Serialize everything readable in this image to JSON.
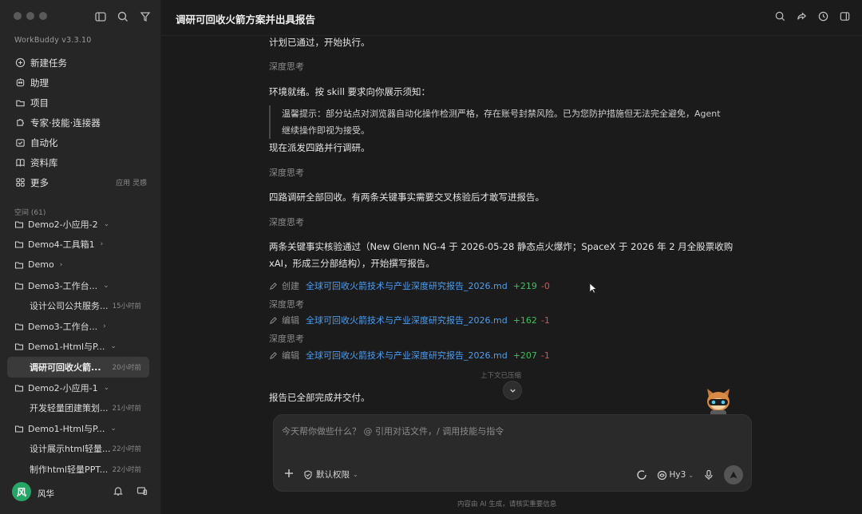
{
  "app": {
    "version": "WorkBuddy v3.3.10"
  },
  "sidebar": {
    "nav": [
      {
        "label": "新建任务",
        "icon": "plus-circle-icon"
      },
      {
        "label": "助理",
        "icon": "assistant-icon"
      },
      {
        "label": "项目",
        "icon": "project-icon"
      },
      {
        "label": "专家·技能·连接器",
        "icon": "puzzle-icon"
      },
      {
        "label": "自动化",
        "icon": "calendar-check-icon"
      },
      {
        "label": "资料库",
        "icon": "book-icon"
      },
      {
        "label": "更多",
        "icon": "apps-icon",
        "extra": "应用 灵感"
      }
    ],
    "space_label": "空间 (61)",
    "tree": [
      {
        "type": "folder",
        "label": "Demo2-小应用-2",
        "chevron": "⌄"
      },
      {
        "type": "folder",
        "label": "Demo4-工具箱1",
        "chevron": "›"
      },
      {
        "type": "folder",
        "label": "Demo",
        "chevron": "›"
      },
      {
        "type": "folder",
        "label": "Demo3-工作台...",
        "chevron": "⌄"
      },
      {
        "type": "child",
        "label": "设计公司公共服务...",
        "time": "15小时前"
      },
      {
        "type": "folder",
        "label": "Demo3-工作台...",
        "chevron": "›"
      },
      {
        "type": "folder",
        "label": "Demo1-Html与P...",
        "chevron": "⌄"
      },
      {
        "type": "child",
        "label": "调研可回收火箭...",
        "time": "20小时前",
        "active": true
      },
      {
        "type": "folder",
        "label": "Demo2-小应用-1",
        "chevron": "⌄"
      },
      {
        "type": "child",
        "label": "开发轻量团建策划...",
        "time": "21小时前"
      },
      {
        "type": "folder",
        "label": "Demo1-Html与P...",
        "chevron": "⌄"
      },
      {
        "type": "child",
        "label": "设计展示html轻量...",
        "time": "22小时前"
      },
      {
        "type": "child",
        "label": "制作html轻量PPT...",
        "time": "22小时前"
      }
    ],
    "user": {
      "name": "风华",
      "avatar_letter": "风"
    }
  },
  "header": {
    "title": "调研可回收火箭方案并出具报告"
  },
  "chat": {
    "plan_passed": "计划已通过，开始执行。",
    "think1": "深度思考",
    "env_ready": "环境就绪。按 skill 要求向你展示须知：",
    "notice_line1": "温馨提示：部分站点对浏览器自动化操作检测严格，存在账号封禁风险。已为您防护措施但无法完全避免，Agent",
    "notice_line2": "继续操作即视为接受。",
    "dispatch": "现在派发四路并行调研。",
    "think2": "深度思考",
    "all_back": "四路调研全部回收。有两条关键事实需要交叉核验后才敢写进报告。",
    "think3": "深度思考",
    "verified_line1": "两条关键事实核验通过（New Glenn NG-4 于 2026-05-28 静态点火爆炸；SpaceX 于 2026 年 2 月全股票收购",
    "verified_line2": "xAI，形成三分部结构），开始撰写报告。",
    "file_ops": [
      {
        "verb": "创建",
        "file": "全球可回收火箭技术与产业深度研究报告_2026.md",
        "added": "+219",
        "removed": "-0"
      },
      {
        "verb": "编辑",
        "file": "全球可回收火箭技术与产业深度研究报告_2026.md",
        "added": "+162",
        "removed": "-1"
      },
      {
        "verb": "编辑",
        "file": "全球可回收火箭技术与产业深度研究报告_2026.md",
        "added": "+207",
        "removed": "-1"
      }
    ],
    "think4": "深度思考",
    "think5": "深度思考",
    "context_compressed": "上下文已压缩",
    "delivered": "报告已全部完成并交付。"
  },
  "composer": {
    "placeholder": "今天帮你做些什么？ @ 引用对话文件，/ 调用技能与指令",
    "permission": "默认权限",
    "model": "Hy3"
  },
  "footer": {
    "note": "内容由 AI 生成，请核实重要信息"
  },
  "colors": {
    "link": "#4a9ff5",
    "added": "#3fbf5f",
    "removed": "#e0514a",
    "avatar": "#27a567"
  }
}
